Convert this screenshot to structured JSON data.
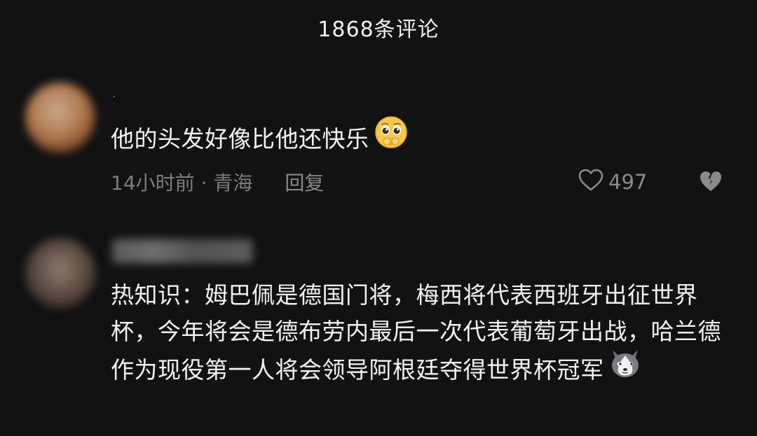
{
  "header": {
    "title": "1868条评论"
  },
  "comments": [
    {
      "username": "·",
      "text": "他的头发好像比他还快乐",
      "emoji": "pleading-face-emoji",
      "time_location": "14小时前 · 青海",
      "reply_label": "回复",
      "like_count": "497",
      "like_icon": "heart-outline-icon",
      "dislike_icon": "broken-heart-icon"
    },
    {
      "username": "",
      "text": "热知识：姆巴佩是德国门将，梅西将代表西班牙出征世界杯，今年将会是德布劳内最后一次代表葡萄牙出战，哈兰德作为现役第一人将会领导阿根廷夺得世界杯冠军",
      "emoji": "husky-dog-emoji"
    }
  ],
  "colors": {
    "background": "#121212",
    "text_primary": "#f2f2f2",
    "text_secondary": "#7c7c7c"
  }
}
